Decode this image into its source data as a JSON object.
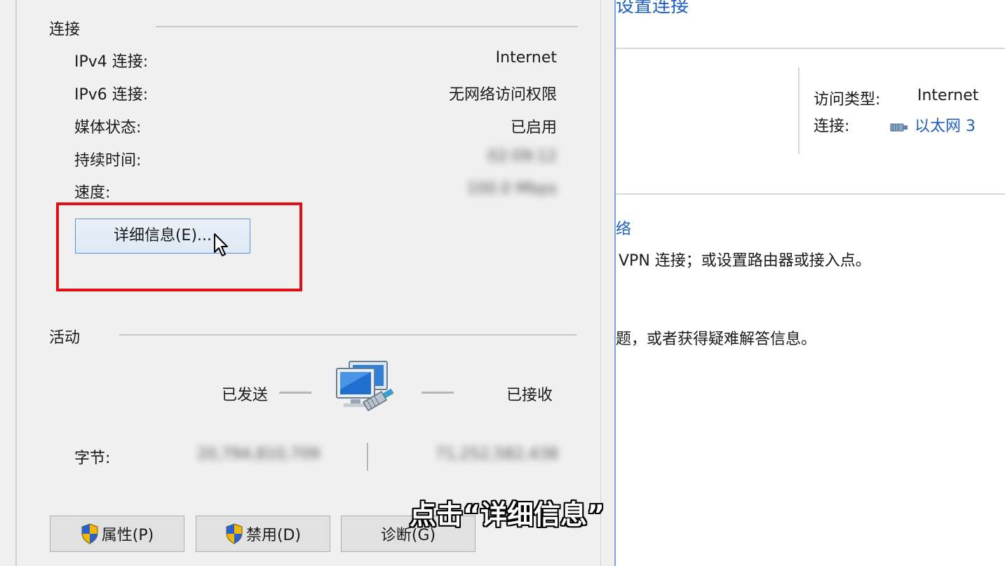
{
  "background": {
    "heading": "设置连接",
    "access_type_label": "访问类型:",
    "access_type_value": "Internet",
    "connection_label": "连接:",
    "connection_value": "以太网 3",
    "network_heading": "络",
    "vpn_text": "VPN 连接；或设置路由器或接入点。",
    "troubleshoot_text": "题，或者获得疑难解答信息。"
  },
  "dialog": {
    "connection_group": "连接",
    "rows": [
      {
        "label": "IPv4 连接:",
        "value": "Internet"
      },
      {
        "label": "IPv6 连接:",
        "value": "无网络访问权限"
      },
      {
        "label": "媒体状态:",
        "value": "已启用"
      },
      {
        "label": "持续时间:",
        "value": "02:09:12"
      },
      {
        "label": "速度:",
        "value": "100.0 Mbps"
      }
    ],
    "details_button": "详细信息(E)...",
    "activity_group": "活动",
    "sent_label": "已发送",
    "received_label": "已接收",
    "bytes_label": "字节:",
    "bytes_sent": "20,794,810,709",
    "bytes_received": "71,252,582,438",
    "properties_button": "属性(P)",
    "disable_button": "禁用(D)",
    "diagnose_button": "诊断(G)"
  },
  "caption": "点击“详细信息”",
  "colors": {
    "highlight": "#e01010",
    "link": "#1f5fbf",
    "dialog_bg": "#f0f0f0"
  }
}
